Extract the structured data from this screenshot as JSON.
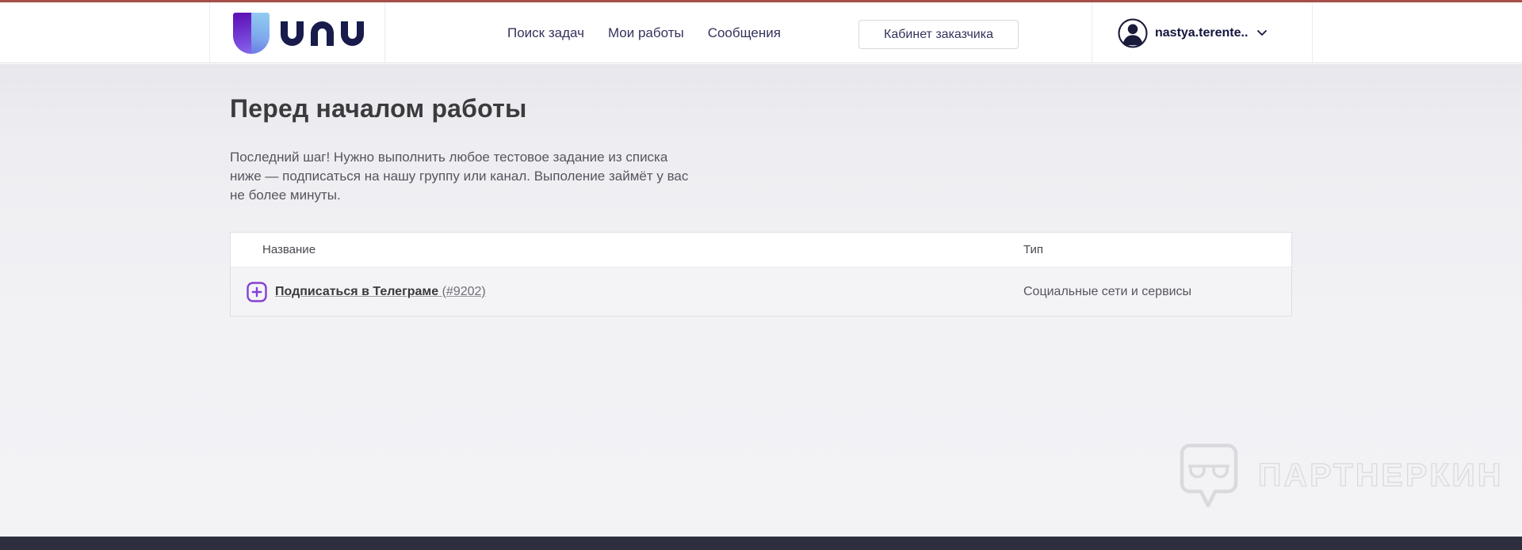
{
  "brand": {
    "logo_text": "unu"
  },
  "header": {
    "nav": [
      {
        "label": "Поиск задач"
      },
      {
        "label": "Мои работы"
      },
      {
        "label": "Сообщения"
      }
    ],
    "client_cabinet_button": "Кабинет заказчика",
    "username": "nastya.terente.."
  },
  "main": {
    "title": "Перед началом работы",
    "intro": "Последний шаг! Нужно выполнить любое тестовое задание из списка\nниже — подписаться на нашу группу или канал. Выполение займёт у вас\nне более минуты.",
    "table": {
      "columns": [
        "Название",
        "Тип"
      ],
      "rows": [
        {
          "name": "Подписаться в Телеграме",
          "id": "(#9202)",
          "type": "Социальные сети и сервисы"
        }
      ]
    }
  },
  "watermark": {
    "text": "ПАРТНЕРКИН"
  },
  "colors": {
    "topbar": "#a5504b",
    "navy": "#181b4b",
    "accent": "#8440d6",
    "footer": "#2e2f3e",
    "logo_purple": "#5f14b8",
    "logo_blue": "#90cbf2"
  }
}
